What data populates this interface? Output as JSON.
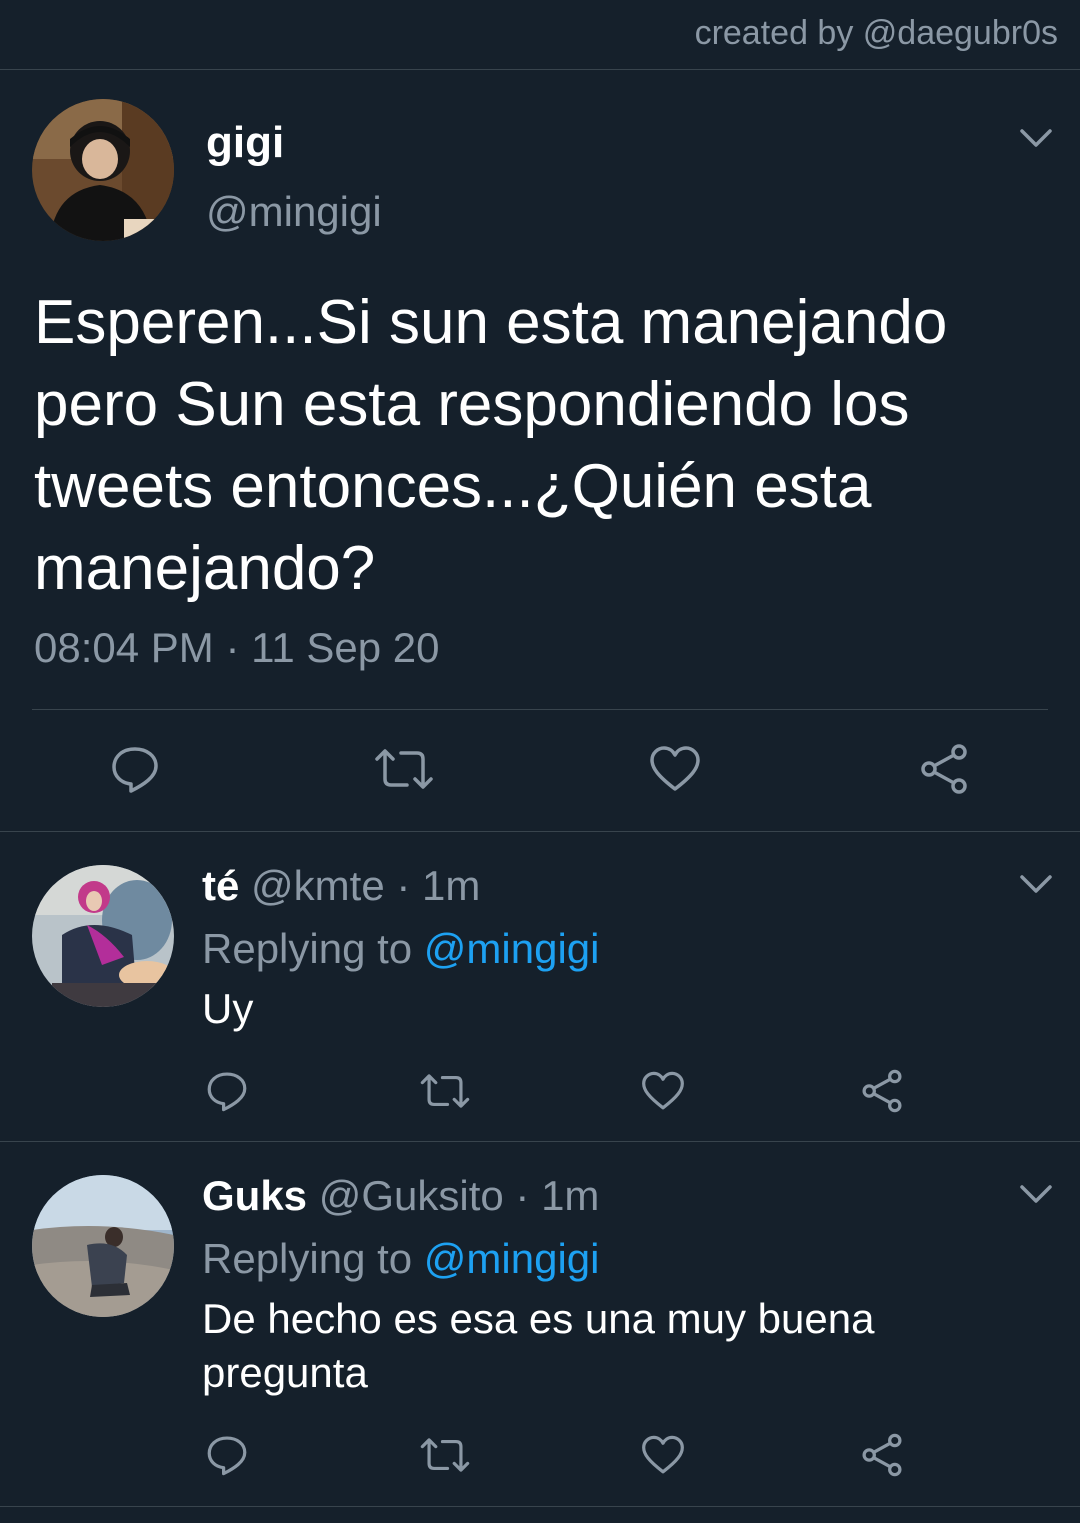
{
  "credit": "created by @daegubr0s",
  "colors": {
    "background": "#15202b",
    "secondary_text": "#8b98a5",
    "link": "#1da1f2",
    "divider": "#38444d"
  },
  "main_tweet": {
    "name": "gigi",
    "handle": "@mingigi",
    "text": "Esperen...Si sun esta manejando pero Sun esta respondiendo los tweets entonces...¿Quién esta manejando?",
    "timestamp": "08:04 PM · 11 Sep 20",
    "actions": [
      "reply-icon",
      "retweet-icon",
      "like-icon",
      "share-icon"
    ]
  },
  "replies": [
    {
      "name": "té",
      "handle": "@kmte",
      "time": "· 1m",
      "replying_label": "Replying to",
      "replying_to": "@mingigi",
      "text": "Uy"
    },
    {
      "name": "Guks",
      "handle": "@Guksito",
      "time": "· 1m",
      "replying_label": "Replying to",
      "replying_to": "@mingigi",
      "text": "De hecho es esa es una muy buena pregunta"
    }
  ]
}
